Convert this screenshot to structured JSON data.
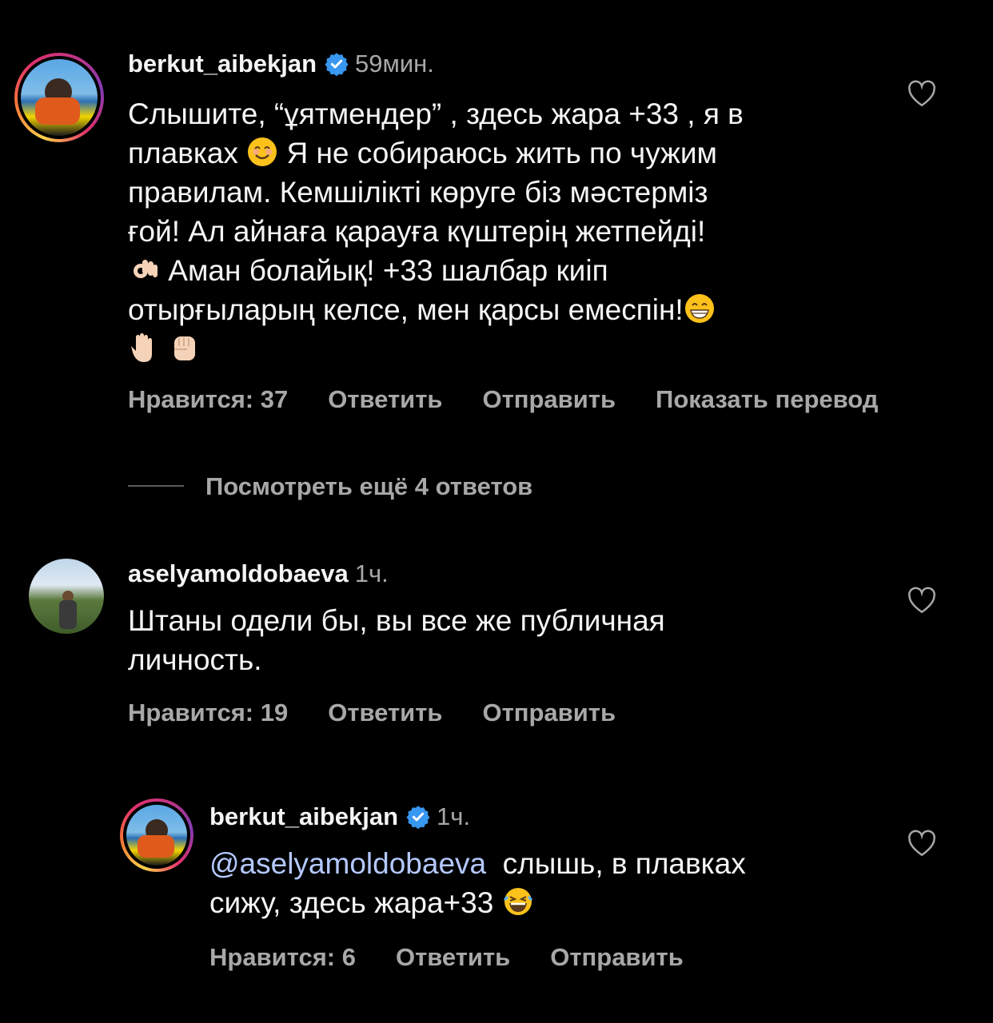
{
  "comment1": {
    "username": "berkut_aibekjan",
    "time": "59мин.",
    "text_l1": "Слышите, “ұятмендер” , здесь жара +33 , я в",
    "text_l2a": "плавках",
    "text_l2b": "Я не собираюсь жить по чужим",
    "text_l3": "правилам. Кемшілікті көруге біз мәстерміз",
    "text_l4": "ғой! Ал айнаға қарауға күштерің жетпейді!",
    "text_l5": "Аман болайық! +33 шалбар киіп",
    "text_l6": "отырғыларың келсе, мен қарсы емеспін!",
    "likes": "Нравится: 37",
    "reply": "Ответить",
    "send": "Отправить",
    "translate": "Показать перевод"
  },
  "view_more": "Посмотреть ещё 4 ответов",
  "comment2": {
    "username": "aselyamoldobaeva",
    "time": "1ч.",
    "text_l1": "Штаны одели бы, вы все же публичная",
    "text_l2": "личность.",
    "likes": "Нравится: 19",
    "reply": "Ответить",
    "send": "Отправить"
  },
  "comment3": {
    "username": "berkut_aibekjan",
    "time": "1ч.",
    "mention": "@aselyamoldobaeva",
    "text_l1": "слышь, в плавках",
    "text_l2": "сижу, здесь жара+33",
    "likes": "Нравится: 6",
    "reply": "Ответить",
    "send": "Отправить"
  },
  "colors": {
    "background": "#000000",
    "text": "#f5f5f5",
    "muted": "#a8a8a8",
    "verified": "#3897f0",
    "mention": "#b4c8ff"
  },
  "icons": [
    "verified-badge-icon",
    "heart-icon",
    "smile-emoji-icon",
    "ok-hand-emoji-icon",
    "grin-emoji-icon",
    "raised-hand-emoji-icon",
    "fist-emoji-icon",
    "laughing-tears-emoji-icon"
  ]
}
